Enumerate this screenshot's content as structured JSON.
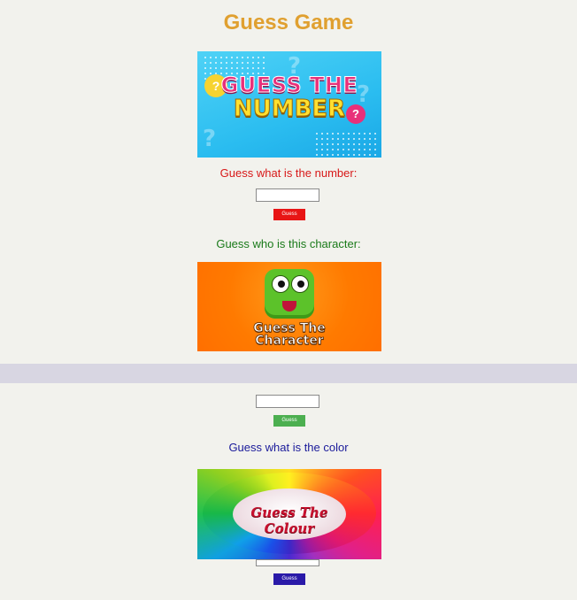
{
  "page": {
    "title": "Guess Game"
  },
  "number_section": {
    "banner_line1": "GUESS THE",
    "banner_line2": "NUMBER",
    "banner_marks": [
      "?",
      "?"
    ],
    "prompt": "Guess what is the number:",
    "input_value": "",
    "button_label": "Guess",
    "button_color": "#e81515"
  },
  "character_section": {
    "prompt": "Guess who is this character:",
    "banner_line1": "Guess The",
    "banner_line2": "Character",
    "input_value": "",
    "button_label": "Guess",
    "button_color": "#4caf50"
  },
  "color_section": {
    "prompt": "Guess what is the color",
    "banner_text": "Guess The Colour",
    "input_value": "",
    "button_label": "Guess",
    "button_color": "#2a1aa8"
  },
  "colors": {
    "title": "#e0a030",
    "number_prompt": "#d81818",
    "character_prompt": "#1a7a1a",
    "color_prompt": "#1a1a9a",
    "background": "#f2f2ed",
    "divider": "#d8d6e2"
  }
}
